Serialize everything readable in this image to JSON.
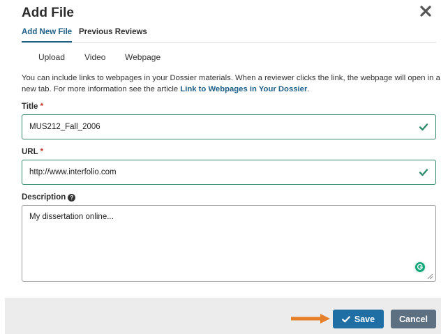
{
  "dialog": {
    "title": "Add File"
  },
  "tabs": [
    {
      "label": "Add New File",
      "active": true
    },
    {
      "label": "Previous Reviews",
      "active": false
    }
  ],
  "subtabs": [
    "Upload",
    "Video",
    "Webpage"
  ],
  "info": {
    "text": "You can include links to webpages in your Dossier materials. When a reviewer clicks the link, the webpage will open in a new tab. For more information see the article ",
    "link": "Link to Webpages in Your Dossier",
    "end": "."
  },
  "fields": {
    "title": {
      "label": "Title",
      "required_mark": "*",
      "value": "MUS212_Fall_2006"
    },
    "url": {
      "label": "URL",
      "required_mark": "*",
      "value": "http://www.interfolio.com"
    },
    "description": {
      "label": "Description",
      "help_icon": "?",
      "value": "My dissertation online..."
    }
  },
  "footer": {
    "save_label": "Save",
    "cancel_label": "Cancel"
  },
  "colors": {
    "accent": "#1f5f86",
    "valid": "#2e8b6c",
    "save": "#1f6fa4",
    "cancel": "#5d7081",
    "arrow": "#e57f2a"
  },
  "icons": [
    "close-icon",
    "checkmark-icon",
    "help-icon",
    "grammarly-icon",
    "resize-grip-icon",
    "arrow-right-icon"
  ]
}
